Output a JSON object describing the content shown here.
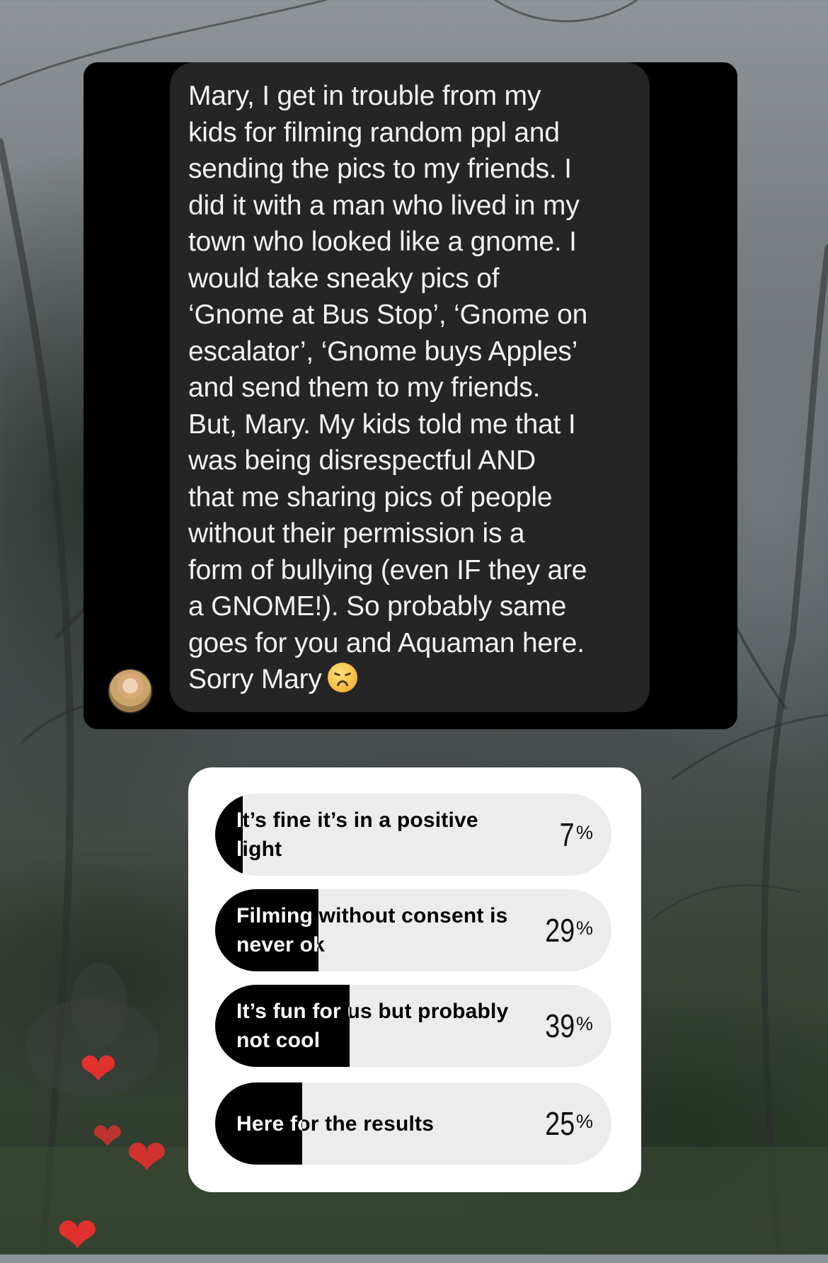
{
  "message": {
    "text": "Mary, I get in trouble from my\nkids for filming random ppl and\nsending the pics to my friends. I\ndid it with a man who lived in my\ntown who looked like a gnome. I\nwould take sneaky pics of\n‘Gnome at Bus Stop’, ‘Gnome on\nescalator’, ‘Gnome buys Apples’\nand send them to my friends.\nBut, Mary. My kids told me that I\nwas being disrespectful AND\nthat me sharing pics of people\nwithout their permission is a\nform of bullying (even IF they are\na GNOME!). So probably same\ngoes for you and Aquaman here.\nSorry Mary",
    "emoji": "disappointed-face-emoji"
  },
  "poll": {
    "options": [
      {
        "label": "It’s fine it’s in a positive light",
        "percent": "7",
        "fill": 0.07
      },
      {
        "label": "Filming without consent is never ok",
        "percent": "29",
        "fill": 0.26
      },
      {
        "label": "It’s fun for us but probably not cool",
        "percent": "39",
        "fill": 0.34
      },
      {
        "label": "Here for the results",
        "percent": "25",
        "fill": 0.22
      }
    ],
    "percent_sign": "%"
  },
  "colors": {
    "bubble": "#252525",
    "card": "#000000",
    "poll_fill": "#000000",
    "poll_track": "#ececec",
    "heart": "#e0312f"
  }
}
